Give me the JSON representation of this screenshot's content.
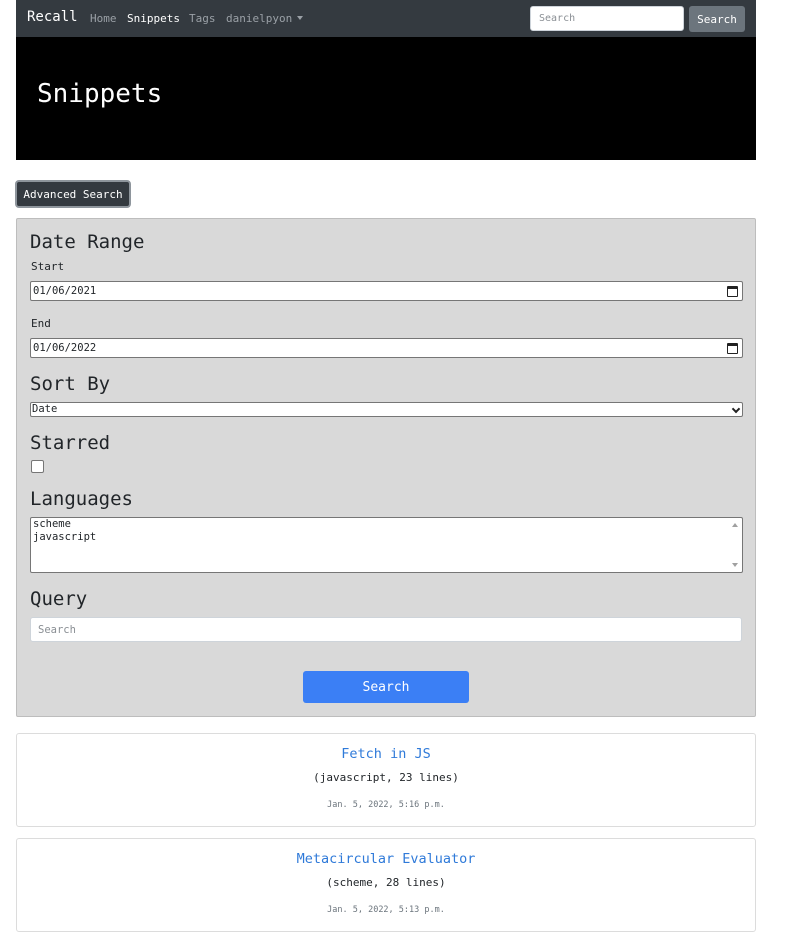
{
  "navbar": {
    "brand": "Recall",
    "links": [
      {
        "label": "Home"
      },
      {
        "label": "Snippets"
      },
      {
        "label": "Tags"
      },
      {
        "label": "danielpyon"
      }
    ],
    "search_placeholder": "Search",
    "search_button": "Search",
    "bg_color": "#343a40"
  },
  "hero": {
    "title": "Snippets"
  },
  "advanced_search": {
    "toggle_label": "Advanced Search",
    "date_range_heading": "Date Range",
    "start_label": "Start",
    "start_value": "01/06/2021",
    "end_label": "End",
    "end_value": "01/06/2022",
    "sort_heading": "Sort By",
    "sort_value": "Date",
    "starred_heading": "Starred",
    "starred_checked": false,
    "languages_heading": "Languages",
    "languages": [
      "scheme",
      "javascript"
    ],
    "query_heading": "Query",
    "query_placeholder": "Search",
    "submit_label": "Search",
    "accent_color": "#3b7ff5"
  },
  "snippets": [
    {
      "title": "Fetch in JS",
      "meta": "(javascript, 23 lines)",
      "date": "Jan. 5, 2022, 5:16 p.m."
    },
    {
      "title": "Metacircular Evaluator",
      "meta": "(scheme, 28 lines)",
      "date": "Jan. 5, 2022, 5:13 p.m."
    }
  ]
}
